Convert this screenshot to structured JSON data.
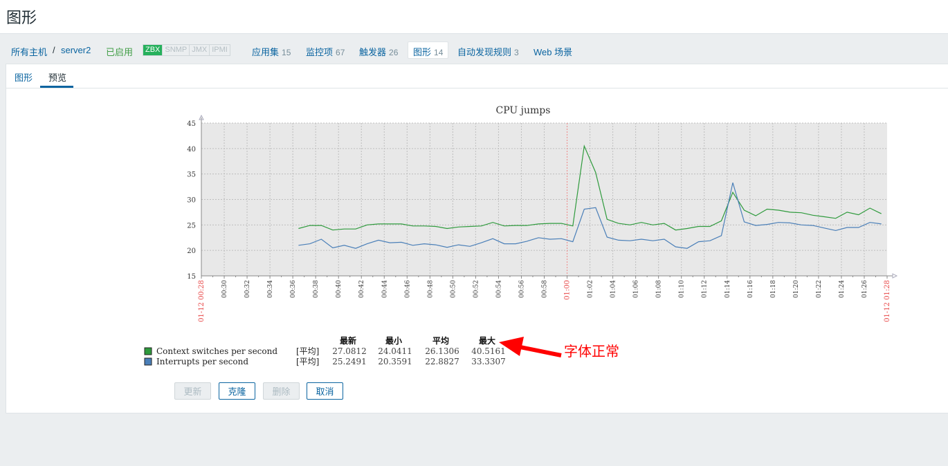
{
  "page_title": "图形",
  "breadcrumb": {
    "all_hosts": "所有主机",
    "separator": "/",
    "host": "server2",
    "status": "已启用",
    "availability": [
      "ZBX",
      "SNMP",
      "JMX",
      "IPMI"
    ]
  },
  "nav": [
    {
      "label": "应用集",
      "count": "15"
    },
    {
      "label": "监控项",
      "count": "67"
    },
    {
      "label": "触发器",
      "count": "26"
    },
    {
      "label": "图形",
      "count": "14"
    },
    {
      "label": "自动发现规则",
      "count": "3"
    },
    {
      "label": "Web 场景",
      "count": ""
    }
  ],
  "tabs": [
    "图形",
    "预览"
  ],
  "buttons": {
    "update": "更新",
    "clone": "克隆",
    "delete": "删除",
    "cancel": "取消"
  },
  "annotation": "字体正常",
  "colors": {
    "series_green": "#2e9a3c",
    "series_blue": "#4a7fb8",
    "link": "#0a64a0",
    "annotation": "#ff0000"
  },
  "chart_data": {
    "type": "line",
    "title": "CPU jumps",
    "ylim": [
      15,
      45
    ],
    "yticks": [
      "45",
      "40",
      "35",
      "30",
      "25",
      "20",
      "15"
    ],
    "grid": true,
    "start_label": "01-12 00:28",
    "end_label": "01-12 01:28",
    "hour_label": "01:00",
    "x_tick_labels": [
      "00:30",
      "00:32",
      "00:34",
      "00:36",
      "00:38",
      "00:40",
      "00:42",
      "00:44",
      "00:46",
      "00:48",
      "00:50",
      "00:52",
      "00:54",
      "00:56",
      "00:58",
      "01:02",
      "01:04",
      "01:06",
      "01:08",
      "01:10",
      "01:12",
      "01:14",
      "01:16",
      "01:18",
      "01:20",
      "01:22",
      "01:24",
      "01:26"
    ],
    "x_minutes": [
      8.5,
      9.5,
      10.5,
      11.5,
      12.5,
      13.5,
      14.5,
      15.5,
      16.5,
      17.5,
      18.5,
      19.5,
      20.5,
      21.5,
      22.5,
      23.5,
      24.5,
      25.5,
      26.5,
      27.5,
      28.5,
      29.5,
      30.5,
      31.5,
      32.5,
      33.5,
      34.5,
      35.5,
      36.5,
      37.5,
      38.5,
      39.5,
      40.5,
      41.5,
      42.5,
      43.5,
      44.5,
      45.5,
      46.5,
      47.5,
      48.5,
      49.5,
      50.5,
      51.5,
      52.5,
      53.5,
      54.5,
      55.5,
      56.5,
      57.5,
      58.5,
      59.5
    ],
    "series": [
      {
        "name": "Context switches per second",
        "color": "#2e9a3c",
        "values": [
          24.3,
          24.9,
          24.9,
          24.0,
          24.2,
          24.2,
          25.0,
          25.2,
          25.2,
          25.2,
          24.8,
          24.8,
          24.7,
          24.3,
          24.6,
          24.7,
          24.8,
          25.5,
          24.8,
          24.9,
          24.9,
          25.2,
          25.3,
          25.3,
          24.8,
          40.5,
          35.3,
          26.1,
          25.3,
          25.0,
          25.5,
          25.0,
          25.3,
          24.0,
          24.3,
          24.7,
          24.7,
          25.8,
          31.4,
          27.9,
          26.8,
          28.1,
          27.9,
          27.5,
          27.4,
          26.9,
          26.6,
          26.3,
          27.5,
          27.0,
          28.3,
          27.2
        ]
      },
      {
        "name": "Interrupts per second",
        "color": "#4a7fb8",
        "values": [
          21.0,
          21.3,
          22.2,
          20.5,
          21.0,
          20.4,
          21.3,
          22.0,
          21.5,
          21.6,
          21.0,
          21.3,
          21.1,
          20.6,
          21.1,
          20.8,
          21.5,
          22.3,
          21.3,
          21.3,
          21.8,
          22.5,
          22.2,
          22.3,
          21.7,
          28.1,
          28.4,
          22.6,
          22.0,
          21.9,
          22.2,
          21.9,
          22.2,
          20.7,
          20.4,
          21.7,
          21.9,
          22.9,
          33.3,
          25.6,
          24.9,
          25.1,
          25.5,
          25.4,
          25.0,
          24.9,
          24.4,
          23.9,
          24.5,
          24.5,
          25.5,
          25.2
        ]
      }
    ],
    "legend_headers": [
      "最新",
      "最小",
      "平均",
      "最大"
    ],
    "legend_rows": [
      {
        "name": "Context switches per second",
        "func": "[平均]",
        "last": "27.0812",
        "min": "24.0411",
        "avg": "26.1306",
        "max": "40.5161"
      },
      {
        "name": "Interrupts per second",
        "func": "[平均]",
        "last": "25.2491",
        "min": "20.3591",
        "avg": "22.8827",
        "max": "33.3307"
      }
    ]
  }
}
